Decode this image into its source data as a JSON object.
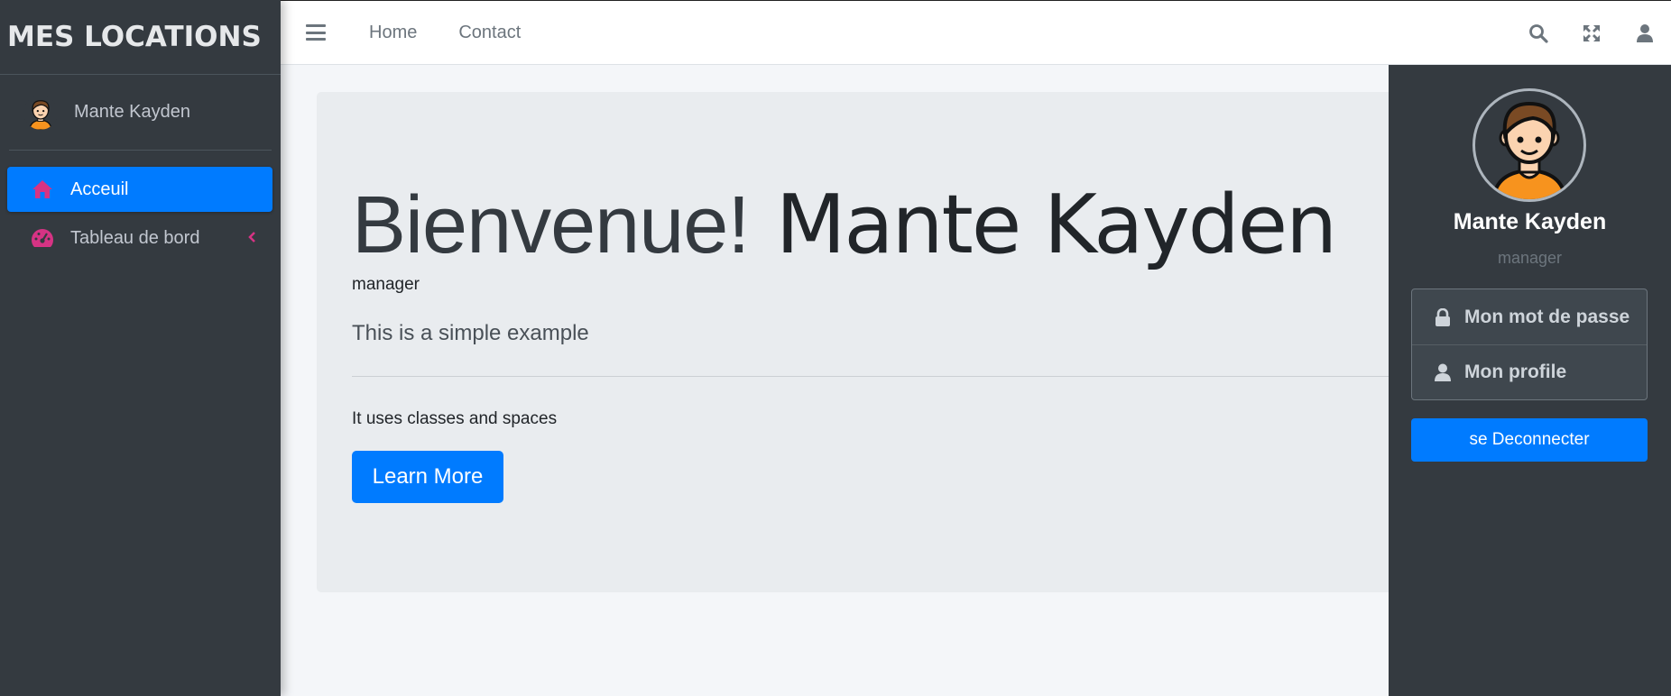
{
  "brand": {
    "title": "MES LOCATIONS"
  },
  "sidebar": {
    "user_name": "Mante Kayden",
    "items": [
      {
        "label": "Acceuil",
        "icon": "home-icon",
        "active": true
      },
      {
        "label": "Tableau de bord",
        "icon": "tachometer-icon",
        "active": false
      }
    ]
  },
  "navbar": {
    "links": [
      "Home",
      "Contact"
    ],
    "icons": [
      "search-icon",
      "expand-icon",
      "user-icon"
    ]
  },
  "jumbotron": {
    "greeting": "Bienvenue!",
    "name": "Mante Kayden",
    "role": "manager",
    "lead": "This is a simple example",
    "text": "It uses classes and spaces",
    "button": "Learn More"
  },
  "control_sidebar": {
    "name": "Mante Kayden",
    "role": "manager",
    "items": [
      {
        "label": "Mon mot de passe",
        "icon": "lock-icon"
      },
      {
        "label": "Mon profile",
        "icon": "user-icon"
      }
    ],
    "logout": "se Deconnecter"
  },
  "colors": {
    "primary": "#007bff",
    "sidebar_bg": "#343a40",
    "icon_pink": "#d63384",
    "jumbotron_bg": "#e9ecef"
  }
}
